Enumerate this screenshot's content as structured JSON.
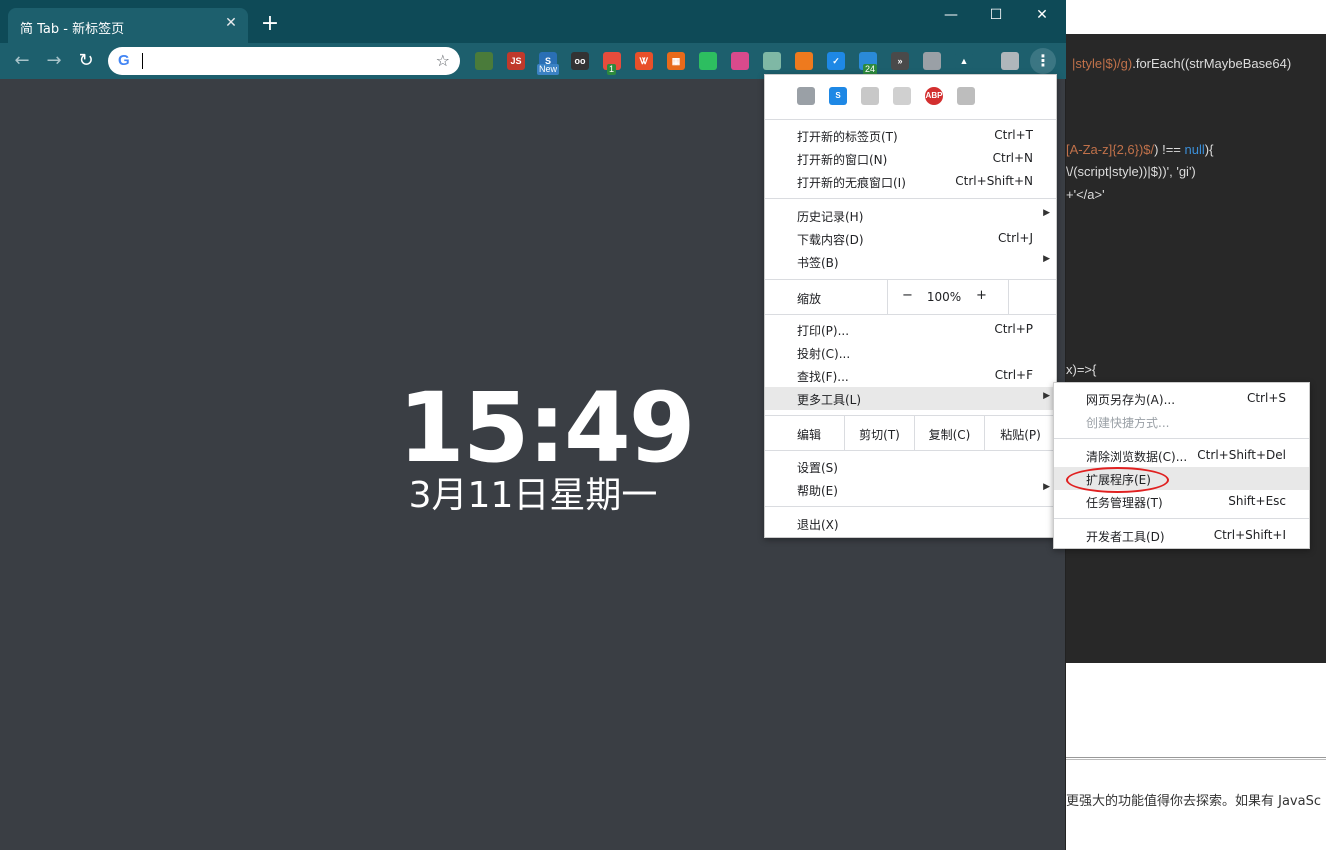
{
  "background_window": {
    "code_lines": [
      {
        "parts": [
          {
            "t": "|style|$)/g)",
            "c": "str"
          },
          {
            "t": ".forEach((strMaybeBase64)",
            "c": ""
          }
        ]
      },
      {
        "parts": [
          {
            "t": "[A-Za-z]{2,6})$/",
            "c": "str"
          },
          {
            "t": ") !== ",
            "c": ""
          },
          {
            "t": "null",
            "c": "kw"
          },
          {
            "t": "){",
            "c": ""
          }
        ]
      },
      {
        "parts": [
          {
            "t": "\\/(script|style))|$))', 'gi')",
            "c": ""
          }
        ]
      },
      {
        "parts": [
          {
            "t": "+'</a>'",
            "c": ""
          }
        ]
      },
      {
        "parts": [
          {
            "t": "x)=>{",
            "c": ""
          }
        ]
      }
    ],
    "footer_text": "更强大的功能值得你去探索。如果有 JavaSc"
  },
  "tab": {
    "title": "简 Tab - 新标签页",
    "close": "✕",
    "new": "+"
  },
  "window_controls": {
    "minimize": "—",
    "maximize": "☐",
    "close": "✕"
  },
  "toolbar": {
    "back": "←",
    "forward": "→",
    "reload": "↻",
    "omnibox_value": "",
    "omnibox_icon": "G",
    "star": "☆",
    "menu": "⋮",
    "extensions": [
      {
        "name": "user-ext-icon",
        "label": "",
        "color": "#4a7b3a"
      },
      {
        "name": "js-ext-icon",
        "label": "JS",
        "color": "#c0392b"
      },
      {
        "name": "new-ext-icon",
        "label": "S",
        "color": "#2a6fb5",
        "badge": "New"
      },
      {
        "name": "oo-ext-icon",
        "label": "oo",
        "color": "#333333"
      },
      {
        "name": "red-bubble-ext-icon",
        "label": "",
        "color": "#e74c3c",
        "badge": "1"
      },
      {
        "name": "translate-ext-icon",
        "label": "Ꮤ",
        "color": "#e8502a"
      },
      {
        "name": "qr-ext-icon",
        "label": "▦",
        "color": "#e86a1a"
      },
      {
        "name": "evernote-ext-icon",
        "label": "",
        "color": "#2dbe60"
      },
      {
        "name": "bird-ext-icon",
        "label": "",
        "color": "#d94a8c"
      },
      {
        "name": "box-ext-icon",
        "label": "",
        "color": "#7fb8a5"
      },
      {
        "name": "rss-ext-icon",
        "label": "",
        "color": "#ee7a1e"
      },
      {
        "name": "check-ext-icon",
        "label": "✓",
        "color": "#1e88e5"
      },
      {
        "name": "gear-ext-icon",
        "label": "",
        "color": "#2a8ad8",
        "badge": "24"
      },
      {
        "name": "chevrons-ext-icon",
        "label": "»",
        "color": "#4a4a4a"
      },
      {
        "name": "monitor-ext-icon",
        "label": "",
        "color": "#9aa0a6"
      },
      {
        "name": "warning-ext-icon",
        "label": "▲",
        "color": "#1d5f6d"
      },
      {
        "name": "avatar-icon",
        "label": "",
        "color": "#b0b7bb"
      }
    ]
  },
  "newtab": {
    "time": "15:49",
    "date": "3月11日星期一"
  },
  "menu": {
    "ext_icons": [
      {
        "name": "newspaper-ext-icon",
        "label": "",
        "color": "#9aa0a6"
      },
      {
        "name": "s-ext-icon",
        "label": "S",
        "color": "#1e88e5"
      },
      {
        "name": "image-ext-icon",
        "label": "",
        "color": "#c8c8c8"
      },
      {
        "name": "feather-ext-icon",
        "label": "",
        "color": "#d0d0d0"
      },
      {
        "name": "adblock-ext-icon",
        "label": "ABP",
        "color": "#d32f2f"
      },
      {
        "name": "shield-ext-icon",
        "label": "",
        "color": "#bdbdbd"
      }
    ],
    "new_tab": {
      "label": "打开新的标签页(T)",
      "shortcut": "Ctrl+T"
    },
    "new_window": {
      "label": "打开新的窗口(N)",
      "shortcut": "Ctrl+N"
    },
    "new_incognito": {
      "label": "打开新的无痕窗口(I)",
      "shortcut": "Ctrl+Shift+N"
    },
    "history": {
      "label": "历史记录(H)"
    },
    "downloads": {
      "label": "下载内容(D)",
      "shortcut": "Ctrl+J"
    },
    "bookmarks": {
      "label": "书签(B)"
    },
    "zoom": {
      "label": "缩放",
      "minus": "−",
      "value": "100%",
      "plus": "+"
    },
    "print": {
      "label": "打印(P)...",
      "shortcut": "Ctrl+P"
    },
    "cast": {
      "label": "投射(C)..."
    },
    "find": {
      "label": "查找(F)...",
      "shortcut": "Ctrl+F"
    },
    "more_tools": {
      "label": "更多工具(L)"
    },
    "edit": {
      "label": "编辑",
      "cut": "剪切(T)",
      "copy": "复制(C)",
      "paste": "粘贴(P)"
    },
    "settings": {
      "label": "设置(S)"
    },
    "help": {
      "label": "帮助(E)"
    },
    "exit": {
      "label": "退出(X)"
    },
    "arrow": "▶"
  },
  "submenu": {
    "save_page": {
      "label": "网页另存为(A)...",
      "shortcut": "Ctrl+S"
    },
    "create_shortcut": {
      "label": "创建快捷方式..."
    },
    "clear_data": {
      "label": "清除浏览数据(C)...",
      "shortcut": "Ctrl+Shift+Del"
    },
    "extensions": {
      "label": "扩展程序(E)"
    },
    "task_manager": {
      "label": "任务管理器(T)",
      "shortcut": "Shift+Esc"
    },
    "devtools": {
      "label": "开发者工具(D)",
      "shortcut": "Ctrl+Shift+I"
    }
  }
}
